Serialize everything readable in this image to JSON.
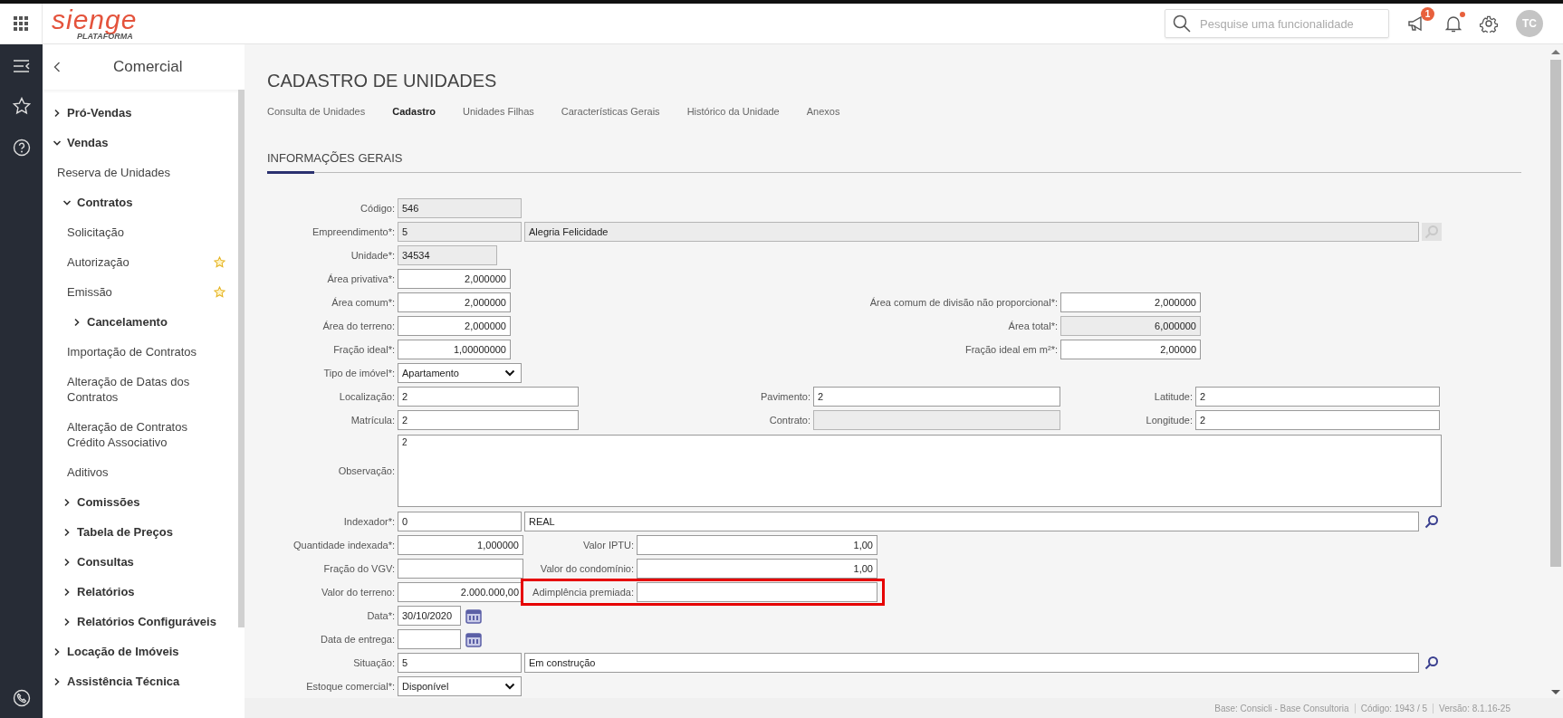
{
  "topbar": {
    "logo": {
      "name": "sienge",
      "tagline": "PLATAFORMA"
    },
    "search": {
      "placeholder": "Pesquise uma funcionalidade"
    },
    "announcements_badge": "1",
    "notifications_unread": true,
    "avatar": "TC"
  },
  "sidebar": {
    "title": "Comercial",
    "items": [
      {
        "label": "Pró-Vendas",
        "kind": "group",
        "expanded": false,
        "starred": false
      },
      {
        "label": "Vendas",
        "kind": "group",
        "expanded": true,
        "starred": false,
        "children": [
          {
            "label": "Reserva de Unidades",
            "kind": "link",
            "starred": false
          },
          {
            "label": "Contratos",
            "kind": "group",
            "expanded": true,
            "starred": false,
            "children": [
              {
                "label": "Solicitação",
                "kind": "link",
                "starred": false
              },
              {
                "label": "Autorização",
                "kind": "link",
                "starred": true
              },
              {
                "label": "Emissão",
                "kind": "link",
                "starred": true
              },
              {
                "label": "Cancelamento",
                "kind": "group",
                "expanded": false,
                "starred": false
              },
              {
                "label": "Importação de Contratos",
                "kind": "link",
                "starred": false
              },
              {
                "label": "Alteração de Datas dos Contratos",
                "kind": "link",
                "starred": false
              },
              {
                "label": "Alteração de Contratos Crédito Associativo",
                "kind": "link",
                "starred": false
              },
              {
                "label": "Aditivos",
                "kind": "link",
                "starred": false
              }
            ]
          },
          {
            "label": "Comissões",
            "kind": "group",
            "expanded": false,
            "starred": false
          },
          {
            "label": "Tabela de Preços",
            "kind": "group",
            "expanded": false,
            "starred": false
          },
          {
            "label": "Consultas",
            "kind": "group",
            "expanded": false,
            "starred": false
          },
          {
            "label": "Relatórios",
            "kind": "group",
            "expanded": false,
            "starred": false
          },
          {
            "label": "Relatórios Configuráveis",
            "kind": "group",
            "expanded": false,
            "starred": false
          }
        ]
      },
      {
        "label": "Locação de Imóveis",
        "kind": "group",
        "expanded": false,
        "starred": false
      },
      {
        "label": "Assistência Técnica",
        "kind": "group",
        "expanded": false,
        "starred": false
      }
    ]
  },
  "page": {
    "title": "CADASTRO DE UNIDADES",
    "tabs": [
      {
        "label": "Consulta de Unidades",
        "selected": false
      },
      {
        "label": "Cadastro",
        "selected": true
      },
      {
        "label": "Unidades Filhas",
        "selected": false
      },
      {
        "label": "Características Gerais",
        "selected": false
      },
      {
        "label": "Histórico da Unidade",
        "selected": false
      },
      {
        "label": "Anexos",
        "selected": false
      }
    ],
    "section": "INFORMAÇÕES GERAIS",
    "form_rows": [
      {
        "kind": "single",
        "label": "Código:",
        "fields": [
          {
            "kind": "code",
            "value": "546",
            "readonly": true
          }
        ]
      },
      {
        "kind": "pair",
        "label": "Empreendimento*:",
        "fields": [
          {
            "kind": "code",
            "value": "5",
            "readonly": true
          },
          {
            "kind": "description",
            "value": "Alegria Felicidade",
            "readonly": true
          }
        ],
        "lookup_enabled": false
      },
      {
        "kind": "single",
        "label": "Unidade*:",
        "fields": [
          {
            "kind": "unit",
            "value": "34534",
            "readonly": true
          }
        ]
      },
      {
        "kind": "single",
        "label": "Área privativa*:",
        "fields": [
          {
            "kind": "number",
            "value": "2,000000",
            "readonly": false
          }
        ]
      },
      {
        "kind": "with_right",
        "label": "Área comum*:",
        "fields": [
          {
            "kind": "number",
            "value": "2,000000",
            "readonly": false
          }
        ],
        "extras": [
          {
            "label": "Área comum de divisão não proporcional*:",
            "field": {
              "kind": "number",
              "value": "2,000000",
              "readonly": false
            }
          }
        ]
      },
      {
        "kind": "with_right",
        "label": "Área do terreno:",
        "fields": [
          {
            "kind": "number",
            "value": "2,000000",
            "readonly": false
          }
        ],
        "extras": [
          {
            "label": "Área total*:",
            "field": {
              "kind": "number",
              "value": "6,000000",
              "readonly": true
            }
          }
        ]
      },
      {
        "kind": "with_right",
        "label": "Fração ideal*:",
        "fields": [
          {
            "kind": "number",
            "value": "1,00000000",
            "readonly": false
          }
        ],
        "extras": [
          {
            "label": "Fração ideal em m²*:",
            "field": {
              "kind": "number",
              "value": "2,00000",
              "readonly": false
            }
          }
        ]
      },
      {
        "kind": "single",
        "label": "Tipo de imóvel*:",
        "fields": [
          {
            "kind": "select",
            "value": "Apartamento",
            "readonly": false
          }
        ]
      },
      {
        "kind": "triple",
        "label": "Localização:",
        "fields": [
          {
            "kind": "text",
            "value": "2",
            "readonly": false
          }
        ],
        "extras": [
          {
            "label": "Pavimento:",
            "field": {
              "kind": "text",
              "value": "2",
              "readonly": false
            }
          },
          {
            "label": "Latitude:",
            "field": {
              "kind": "text",
              "value": "2",
              "readonly": false
            }
          }
        ]
      },
      {
        "kind": "triple",
        "label": "Matrícula:",
        "fields": [
          {
            "kind": "text",
            "value": "2",
            "readonly": false
          }
        ],
        "extras": [
          {
            "label": "Contrato:",
            "field": {
              "kind": "text",
              "readonly": true
            }
          },
          {
            "label": "Longitude:",
            "field": {
              "kind": "text",
              "value": "2",
              "readonly": false
            }
          }
        ]
      },
      {
        "kind": "textarea",
        "label": "Observação:",
        "fields": [
          {
            "kind": "textarea",
            "value": "2",
            "readonly": false
          }
        ]
      },
      {
        "kind": "pair",
        "label": "Indexador*:",
        "fields": [
          {
            "kind": "code",
            "value": "0",
            "readonly": false
          },
          {
            "kind": "description",
            "value": "REAL",
            "readonly": false
          }
        ],
        "lookup_enabled": true
      },
      {
        "kind": "double",
        "label": "Quantidade indexada*:",
        "fields": [
          {
            "kind": "number",
            "value": "1,000000",
            "readonly": false
          }
        ],
        "extras": [
          {
            "label": "Valor IPTU:",
            "field": {
              "kind": "number",
              "value": "1,00",
              "readonly": false
            },
            "highlighted": false
          }
        ]
      },
      {
        "kind": "double",
        "label": "Fração do VGV:",
        "fields": [
          {
            "kind": "number",
            "readonly": false
          }
        ],
        "extras": [
          {
            "label": "Valor do condomínio:",
            "field": {
              "kind": "number",
              "value": "1,00",
              "readonly": false
            },
            "highlighted": false
          }
        ]
      },
      {
        "kind": "double",
        "label": "Valor do terreno:",
        "fields": [
          {
            "kind": "number",
            "value": "2.000.000,00",
            "readonly": false
          }
        ],
        "extras": [
          {
            "label": "Adimplência premiada:",
            "field": {
              "kind": "text",
              "readonly": false
            },
            "highlighted": true
          }
        ]
      },
      {
        "kind": "date",
        "label": "Data*:",
        "fields": [
          {
            "kind": "date",
            "value": "30/10/2020",
            "readonly": false
          }
        ]
      },
      {
        "kind": "date",
        "label": "Data de entrega:",
        "fields": [
          {
            "kind": "date",
            "readonly": false
          }
        ]
      },
      {
        "kind": "pair",
        "label": "Situação:",
        "fields": [
          {
            "kind": "code",
            "value": "5",
            "readonly": false
          },
          {
            "kind": "description",
            "value": "Em construção",
            "readonly": false
          }
        ],
        "lookup_enabled": true
      },
      {
        "kind": "single",
        "label": "Estoque comercial*:",
        "fields": [
          {
            "kind": "select",
            "value": "Disponível",
            "readonly": false
          }
        ]
      }
    ]
  },
  "status_bar": [
    "Base: Consicli - Base Consultoria",
    "Código: 1943 / 5",
    "Versão: 8.1.16-25"
  ]
}
